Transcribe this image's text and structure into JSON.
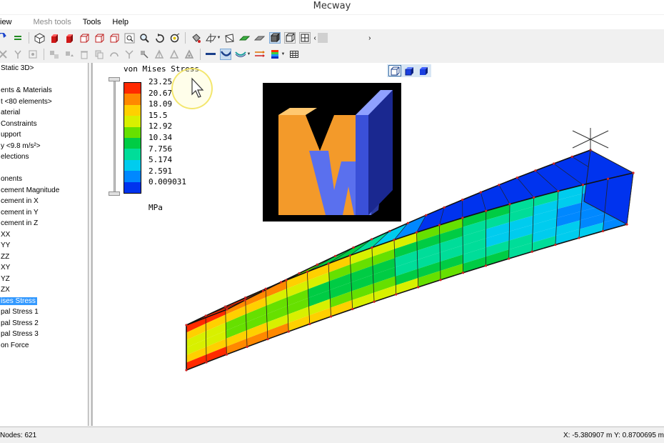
{
  "window": {
    "title": "Mecway"
  },
  "menu": [
    {
      "label": "View",
      "shown": "iew",
      "disabled": false
    },
    {
      "label": "Mesh tools",
      "shown": "Mesh tools",
      "disabled": true
    },
    {
      "label": "Tools",
      "shown": "Tools",
      "disabled": false
    },
    {
      "label": "Help",
      "shown": "Help",
      "disabled": false
    }
  ],
  "tree": {
    "items": [
      {
        "text": "Static 3D>",
        "selected": false
      },
      {
        "text": "",
        "selected": false
      },
      {
        "text": "ents & Materials",
        "selected": false
      },
      {
        "text": "t <80 elements>",
        "selected": false
      },
      {
        "text": "aterial",
        "selected": false
      },
      {
        "text": "Constraints",
        "selected": false
      },
      {
        "text": "upport",
        "selected": false
      },
      {
        "text": "y <9.8 m/s²>",
        "selected": false
      },
      {
        "text": "elections",
        "selected": false
      },
      {
        "text": "",
        "selected": false
      },
      {
        "text": "onents",
        "selected": false
      },
      {
        "text": "cement Magnitude",
        "selected": false
      },
      {
        "text": "cement in X",
        "selected": false
      },
      {
        "text": "cement in Y",
        "selected": false
      },
      {
        "text": "cement in Z",
        "selected": false
      },
      {
        "text": "XX",
        "selected": false
      },
      {
        "text": "YY",
        "selected": false
      },
      {
        "text": "ZZ",
        "selected": false
      },
      {
        "text": "XY",
        "selected": false
      },
      {
        "text": "YZ",
        "selected": false
      },
      {
        "text": "ZX",
        "selected": false
      },
      {
        "text": "ises Stress",
        "selected": true
      },
      {
        "text": "pal Stress 1",
        "selected": false
      },
      {
        "text": "pal Stress 2",
        "selected": false
      },
      {
        "text": "pal Stress 3",
        "selected": false
      },
      {
        "text": "on Force",
        "selected": false
      }
    ]
  },
  "legend": {
    "title": "von Mises Stress",
    "unit": "MPa",
    "values": [
      "23.25",
      "20.67",
      "18.09",
      "15.5",
      "12.92",
      "10.34",
      "7.756",
      "5.174",
      "2.591",
      "0.009031"
    ],
    "colors": [
      "#ff2a00",
      "#ff8800",
      "#ffd000",
      "#d8f000",
      "#66e000",
      "#00cc44",
      "#00dd99",
      "#00ccee",
      "#0088ff",
      "#0033ee"
    ]
  },
  "status": {
    "nodes": "Nodes: 621",
    "coords": "X: -5.380907 m  Y: 0.8700695 m"
  },
  "colors": {
    "selection": "#3399ff",
    "beam_blue": "#1a3fe0",
    "node_red": "#cc2222"
  }
}
